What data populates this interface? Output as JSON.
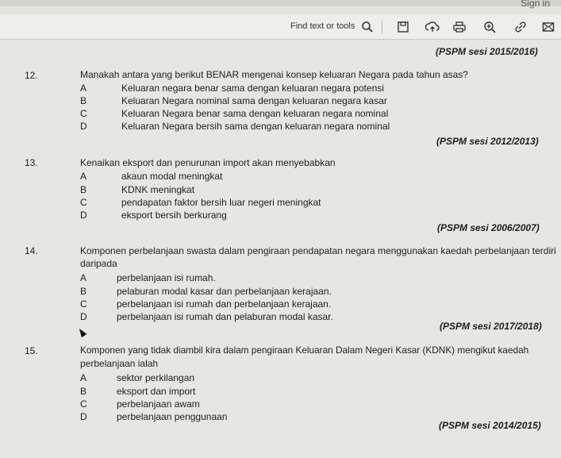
{
  "header": {
    "sign_in": "Sign in"
  },
  "toolbar": {
    "find_label": "Find text or tools",
    "icons": [
      "search-icon",
      "save-icon",
      "upload-icon",
      "print-icon",
      "zoom-icon",
      "link-icon",
      "mail-icon"
    ]
  },
  "questions": [
    {
      "source": "(PSPM sesi 2015/2016)",
      "number": "12.",
      "stem": [
        "Manakah antara yang berikut BENAR mengenai  konsep keluaran Negara pada tahun asas?"
      ],
      "options": [
        {
          "letter": "A",
          "text": "Keluaran negara benar sama dengan keluaran negara potensi"
        },
        {
          "letter": "B",
          "text": "Keluaran Negara nominal sama dengan keluaran negara kasar"
        },
        {
          "letter": "C",
          "text": "Keluaran Negara benar sama dengan keluaran negara nominal"
        },
        {
          "letter": "D",
          "text": "Keluaran Negara bersih sama dengan keluaran negara nominal"
        }
      ]
    },
    {
      "source": "(PSPM sesi 2012/2013)",
      "number": "13.",
      "stem": [
        "Kenaikan eksport dan penurunan import akan menyebabkan"
      ],
      "options": [
        {
          "letter": "A",
          "text": "akaun modal meningkat"
        },
        {
          "letter": "B",
          "text": "KDNK meningkat"
        },
        {
          "letter": "C",
          "text": "pendapatan faktor bersih luar negeri  meningkat"
        },
        {
          "letter": "D",
          "text": "eksport bersih berkurang"
        }
      ]
    },
    {
      "source": "(PSPM sesi 2006/2007)",
      "number": "14.",
      "stem": [
        "Komponen perbelanjaan swasta dalam pengiraan pendapatan negara menggunakan kaedah perbelanjaan terdiri",
        "daripada"
      ],
      "options": [
        {
          "letter": "A",
          "text": "perbelanjaan isi rumah."
        },
        {
          "letter": "B",
          "text": "pelaburan modal kasar dan perbelanjaan kerajaan."
        },
        {
          "letter": "C",
          "text": "perbelanjaan isi rumah dan perbelanjaan kerajaan."
        },
        {
          "letter": "D",
          "text": "perbelanjaan isi rumah dan pelaburan modal kasar."
        }
      ]
    },
    {
      "source": "(PSPM sesi 2017/2018)",
      "number": "15.",
      "stem": [
        "Komponen  yang  tidak  diambil  kira  dalam  pengiraan  Keluaran  Dalam  Negeri  Kasar  (KDNK)  mengikut  kaedah",
        "perbelanjaan ialah"
      ],
      "options": [
        {
          "letter": "A",
          "text": "sektor perkilangan"
        },
        {
          "letter": "B",
          "text": "eksport dan import"
        },
        {
          "letter": "C",
          "text": "perbelanjaan awam"
        },
        {
          "letter": "D",
          "text": "perbelanjaan penggunaan"
        }
      ]
    }
  ],
  "footer_source": "(PSPM sesi 2014/2015)"
}
